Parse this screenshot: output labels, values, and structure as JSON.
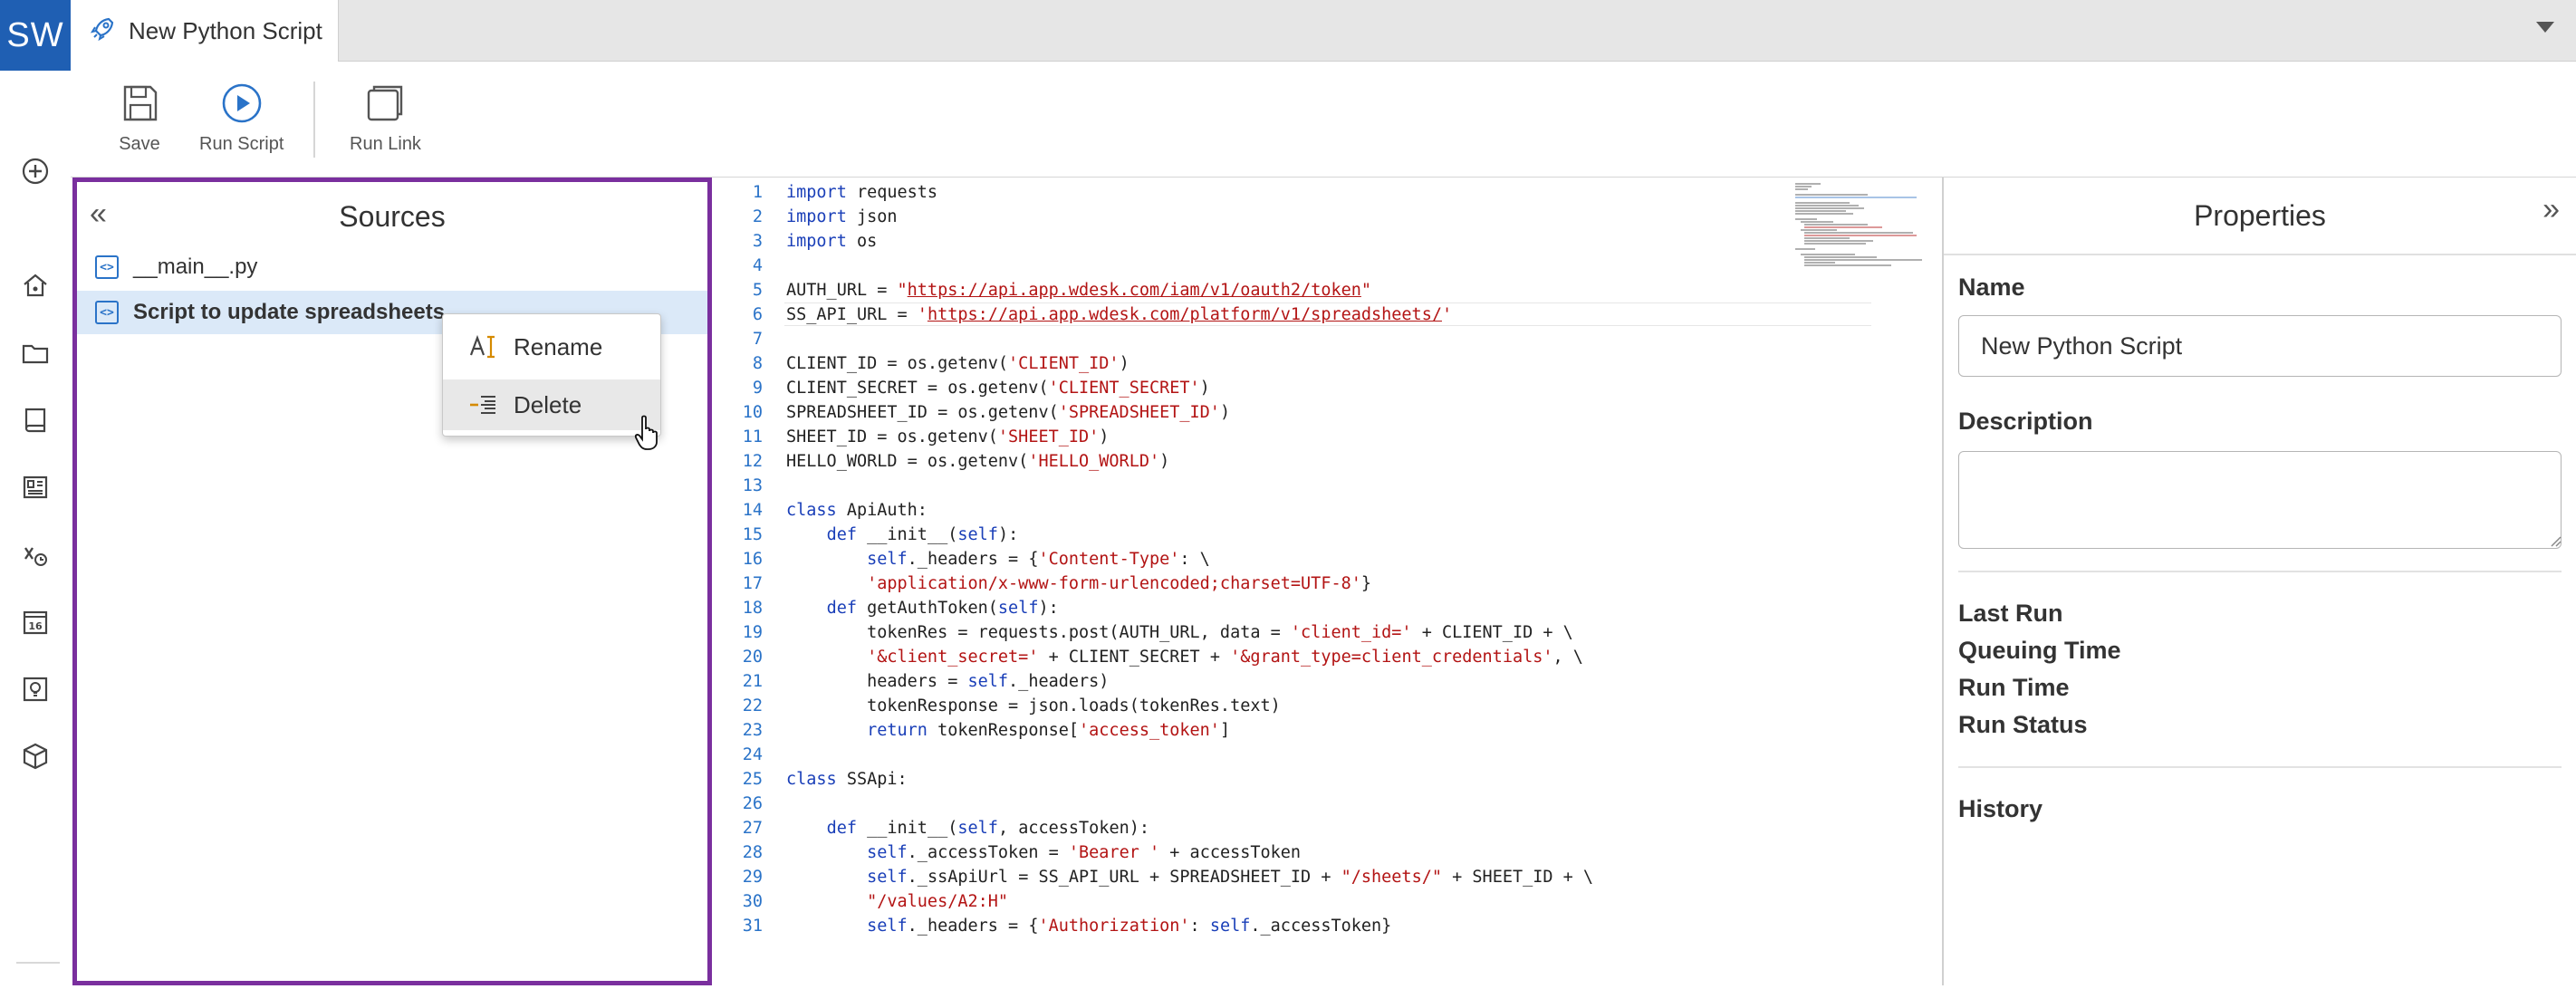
{
  "app": {
    "logo_text": "SW",
    "brand_color": "#1f5fb3",
    "accent_highlight": "#7a2f9e"
  },
  "tab": {
    "title": "New Python Script",
    "icon": "rocket-icon"
  },
  "rail": {
    "items": [
      "add-icon",
      "home-icon",
      "folder-icon",
      "book-icon",
      "dashboard-icon",
      "formula-icon",
      "calendar-icon",
      "lightbulb-icon",
      "cube-icon"
    ]
  },
  "toolbar": {
    "save_label": "Save",
    "run_script_label": "Run Script",
    "run_link_label": "Run Link"
  },
  "sources": {
    "title": "Sources",
    "items": [
      {
        "label": "__main__.py",
        "selected": false
      },
      {
        "label": "Script to update spreadsheets",
        "selected": true
      }
    ]
  },
  "context_menu": {
    "items": [
      {
        "label": "Rename",
        "icon": "rename-icon"
      },
      {
        "label": "Delete",
        "icon": "delete-icon"
      }
    ]
  },
  "editor": {
    "lines": [
      "import requests",
      "import json",
      "import os",
      "",
      "AUTH_URL = \"https://api.app.wdesk.com/iam/v1/oauth2/token\"",
      "SS_API_URL = 'https://api.app.wdesk.com/platform/v1/spreadsheets/'",
      "",
      "CLIENT_ID = os.getenv('CLIENT_ID')",
      "CLIENT_SECRET = os.getenv('CLIENT_SECRET')",
      "SPREADSHEET_ID = os.getenv('SPREADSHEET_ID')",
      "SHEET_ID = os.getenv('SHEET_ID')",
      "HELLO_WORLD = os.getenv('HELLO_WORLD')",
      "",
      "class ApiAuth:",
      "    def __init__(self):",
      "        self._headers = {'Content-Type': \\",
      "        'application/x-www-form-urlencoded;charset=UTF-8'}",
      "    def getAuthToken(self):",
      "        tokenRes = requests.post(AUTH_URL, data = 'client_id=' + CLIENT_ID + \\",
      "        '&client_secret=' + CLIENT_SECRET + '&grant_type=client_credentials', \\",
      "        headers = self._headers)",
      "        tokenResponse = json.loads(tokenRes.text)",
      "        return tokenResponse['access_token']",
      "",
      "class SSApi:",
      "",
      "    def __init__(self, accessToken):",
      "        self._accessToken = 'Bearer ' + accessToken",
      "        self._ssApiUrl = SS_API_URL + SPREADSHEET_ID + \"/sheets/\" + SHEET_ID + \\",
      "        \"/values/A2:H\"",
      "        self._headers = {'Authorization': self._accessToken}"
    ]
  },
  "properties": {
    "title": "Properties",
    "name_label": "Name",
    "name_value": "New Python Script",
    "description_label": "Description",
    "description_value": "",
    "last_run_label": "Last Run",
    "queuing_time_label": "Queuing Time",
    "run_time_label": "Run Time",
    "run_status_label": "Run Status",
    "history_label": "History"
  }
}
